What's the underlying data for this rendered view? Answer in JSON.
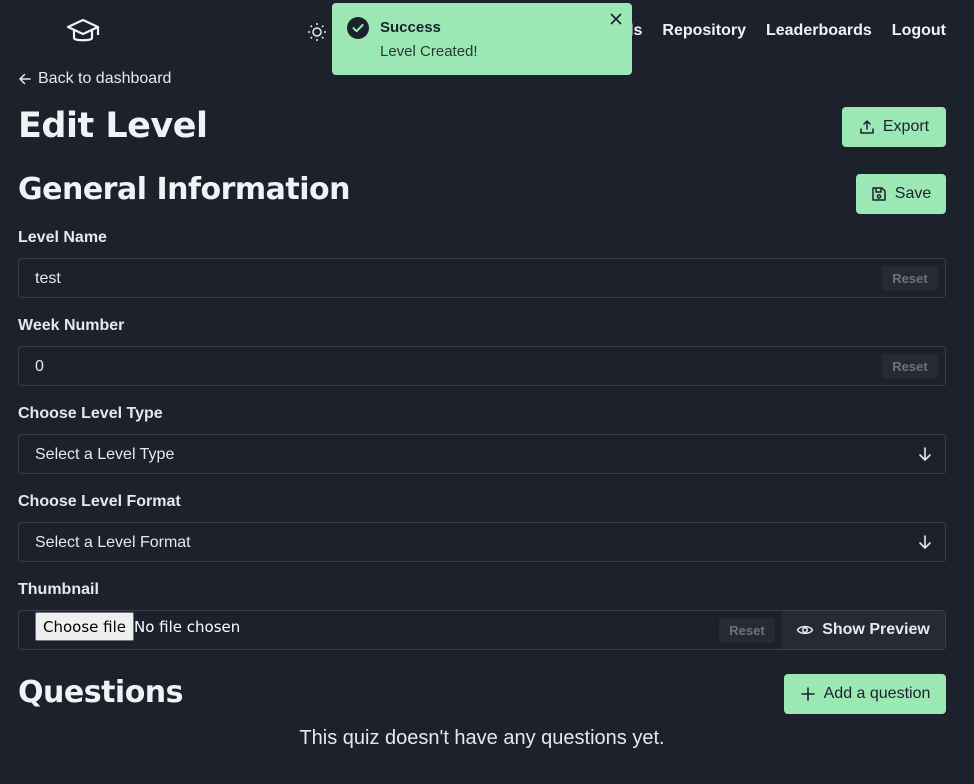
{
  "nav": {
    "links": [
      "vels",
      "Repository",
      "Leaderboards",
      "Logout"
    ],
    "icons": {
      "logo": "graduation-cap-icon",
      "theme": "sun-icon"
    }
  },
  "toast": {
    "title": "Success",
    "message": "Level Created!"
  },
  "back_link": "Back to dashboard",
  "page_title": "Edit Level",
  "export_label": "Export",
  "general": {
    "title": "General Information",
    "save_label": "Save",
    "level_name": {
      "label": "Level Name",
      "value": "test",
      "reset": "Reset"
    },
    "week_number": {
      "label": "Week Number",
      "value": "0",
      "reset": "Reset"
    },
    "level_type": {
      "label": "Choose Level Type",
      "value": "Select a Level Type"
    },
    "level_format": {
      "label": "Choose Level Format",
      "value": "Select a Level Format"
    },
    "thumbnail": {
      "label": "Thumbnail",
      "choose_label": "Choose file",
      "status": "No file chosen",
      "reset": "Reset",
      "preview_label": "Show Preview"
    }
  },
  "questions": {
    "title": "Questions",
    "add_label": "Add a question",
    "empty_message": "This quiz doesn't have any questions yet."
  },
  "colors": {
    "background": "#1d212c",
    "accent": "#9ce8b5",
    "border": "#3a3f4c"
  }
}
